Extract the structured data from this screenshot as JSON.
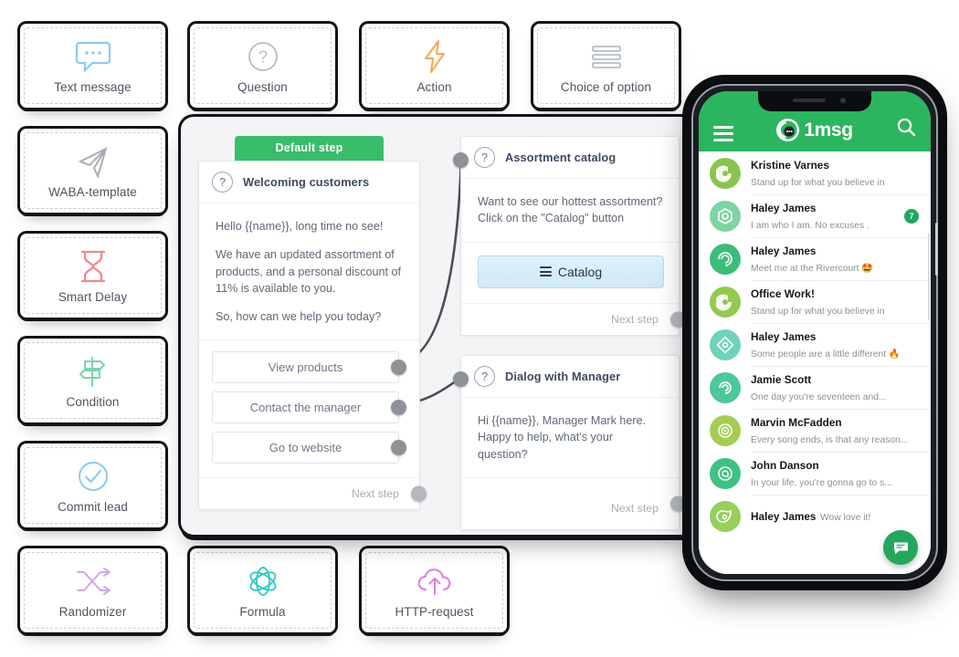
{
  "palette": {
    "blocks": [
      {
        "label": "Text message",
        "icon": "chat-bubble-icon",
        "color": "#8fc9f2"
      },
      {
        "label": "WABA-template",
        "icon": "paper-plane-icon",
        "color": "#a7adb6"
      },
      {
        "label": "Smart Delay",
        "icon": "hourglass-icon",
        "color": "#f2868f"
      },
      {
        "label": "Condition",
        "icon": "signpost-icon",
        "color": "#7bd4ab"
      },
      {
        "label": "Commit lead",
        "icon": "check-circle-icon",
        "color": "#8fc9f2"
      },
      {
        "label": "Randomizer",
        "icon": "shuffle-icon",
        "color": "#d3a7e6"
      },
      {
        "label": "Question",
        "icon": "question-circle-icon",
        "color": "#b6bcc6"
      },
      {
        "label": "Action",
        "icon": "lightning-bolt-icon",
        "color": "#f5a94e"
      },
      {
        "label": "Choice of option",
        "icon": "list-lines-icon",
        "color": "#b6bcc6"
      },
      {
        "label": "Formula",
        "icon": "atom-icon",
        "color": "#2bc9c6"
      },
      {
        "label": "HTTP-request",
        "icon": "cloud-upload-icon",
        "color": "#e07ae0"
      }
    ]
  },
  "canvas": {
    "step_badge": "Default step",
    "next_step_label": "Next step",
    "nodes": {
      "welcoming": {
        "title": "Welcoming customers",
        "icon": "question-circle-icon",
        "paragraphs": [
          "Hello {{name}}, long time no see!",
          "We have an updated assortment of products, and a personal discount of 11% is available to you.",
          "So, how can we help you today?"
        ],
        "replies": [
          "View products",
          "Contact the manager",
          "Go to website"
        ]
      },
      "assortment": {
        "title": "Assortment catalog",
        "icon": "question-circle-icon",
        "paragraphs": [
          "Want to see our hottest assortment? Click on the \"Catalog\" button"
        ],
        "button": {
          "label": "Catalog",
          "icon": "list-lines-icon"
        }
      },
      "dialog": {
        "title": "Dialog with Manager",
        "icon": "question-circle-icon",
        "paragraphs": [
          "Hi {{name}}, Manager Mark here. Happy to help, what's your question?"
        ]
      }
    }
  },
  "phone": {
    "header": {
      "menu_icon": "hamburger-menu-icon",
      "brand": "1msg",
      "brand_icon": "1msg-logo-icon",
      "search_icon": "search-icon",
      "accent": "#2cb55f"
    },
    "fab_icon": "new-message-icon",
    "chats": [
      {
        "name": "Kristine Varnes",
        "message": "Stand up for what you believe in",
        "badge": "",
        "avatar_color": "#8ac44e"
      },
      {
        "name": "Haley James",
        "message": "I am who I am. No excuses .",
        "badge": "7",
        "avatar_color": "#7fd4a3"
      },
      {
        "name": "Haley James",
        "message": "Meet me at the Rivercourt 🤩",
        "badge": "",
        "avatar_color": "#3cbd79"
      },
      {
        "name": "Office Work!",
        "message": "Stand up for what you believe in",
        "badge": "",
        "avatar_color": "#93c94f"
      },
      {
        "name": "Haley James",
        "message": "Some people are a little different 🔥",
        "badge": "",
        "avatar_color": "#6fd3bb"
      },
      {
        "name": "Jamie Scott",
        "message": "One day you're seventeen and...",
        "badge": "",
        "avatar_color": "#4ec79a"
      },
      {
        "name": "Marvin McFadden",
        "message": "Every song ends, is that any reason...",
        "badge": "",
        "avatar_color": "#a6cc52"
      },
      {
        "name": "John Danson",
        "message": "In your life, you're gonna go to s...",
        "badge": "",
        "avatar_color": "#3fc183"
      },
      {
        "name": "Haley James",
        "message": "Wow love it!",
        "badge": "",
        "avatar_color": "#95cf5c"
      }
    ]
  }
}
